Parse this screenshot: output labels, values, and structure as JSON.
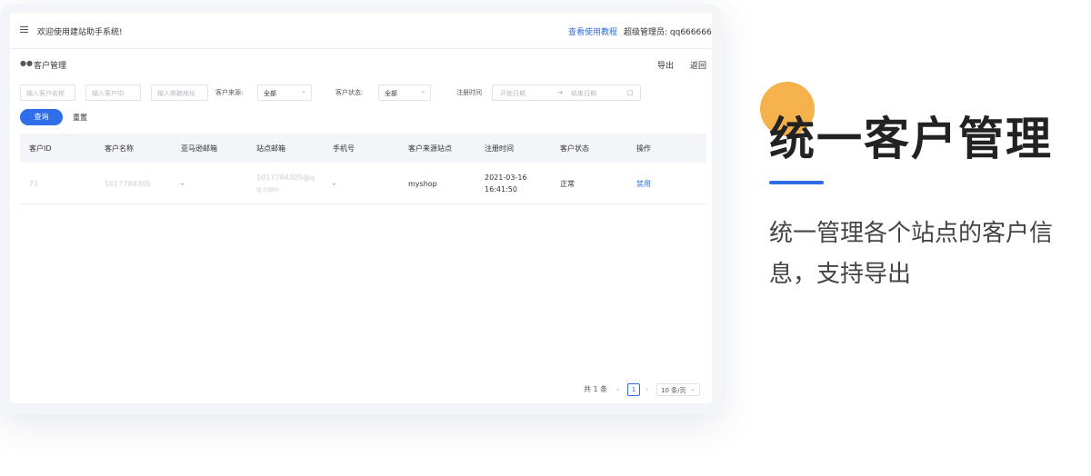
{
  "topbar": {
    "welcome": "欢迎使用建站助手系统!",
    "tutorial_link": "查看使用教程",
    "admin_label": "超级管理员: qq666666"
  },
  "page": {
    "title": "客户管理",
    "export": "导出",
    "back": "返回"
  },
  "filters": {
    "customer_name_placeholder": "输入客户名称",
    "customer_id_placeholder": "输入客户ID",
    "email_placeholder": "输入邮箱地址",
    "source_label": "客户来源:",
    "source_value": "全部",
    "status_label": "客户状态:",
    "status_value": "全部",
    "register_time_label": "注册时间",
    "start_date_placeholder": "开始日期",
    "end_date_placeholder": "结束日期",
    "query_button": "查询",
    "reset_button": "重置"
  },
  "table": {
    "headers": [
      "客户ID",
      "客户名称",
      "亚马逊邮箱",
      "站点邮箱",
      "手机号",
      "客户来源站点",
      "注册时间",
      "客户状态",
      "操作"
    ],
    "rows": [
      {
        "id": "71",
        "name": "1017784305",
        "amazon_email": "-",
        "site_email_1": "1017784305@q",
        "site_email_2": "q.com",
        "phone": "-",
        "source_site": "myshop",
        "register_date": "2021-03-16",
        "register_time": "16:41:50",
        "status": "正常",
        "action": "禁用"
      }
    ]
  },
  "pagination": {
    "total": "共 1 条",
    "current_page": "1",
    "page_size": "10 条/页"
  },
  "promo": {
    "title": "统一客户管理",
    "description": "统一管理各个站点的客户信息，支持导出"
  },
  "colors": {
    "primary": "#2f6ee8",
    "accent": "#f5b14c"
  }
}
